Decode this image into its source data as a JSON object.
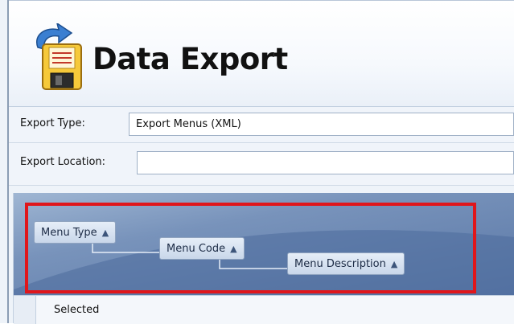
{
  "header": {
    "title": "Data Export",
    "icon": "export-disk-icon"
  },
  "form": {
    "export_type_label": "Export Type:",
    "export_type_value": "Export Menus (XML)",
    "export_location_label": "Export Location:",
    "export_location_value": ""
  },
  "grid": {
    "group_by": [
      {
        "label": "Menu Type",
        "sort": "▲"
      },
      {
        "label": "Menu Code",
        "sort": "▲"
      },
      {
        "label": "Menu Description",
        "sort": "▲"
      }
    ],
    "column_header": "Selected"
  },
  "colors": {
    "highlight": "#e0161b",
    "group_panel": "#6a86b2"
  }
}
